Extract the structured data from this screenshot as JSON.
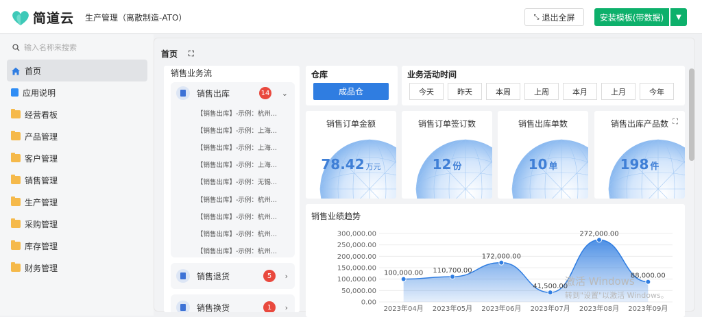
{
  "header": {
    "brand": "简道云",
    "app_title": "生产管理（离散制造-ATO）",
    "exit_fullscreen": "退出全屏",
    "install_button": "安装模板(带数据)"
  },
  "sidebar": {
    "search_placeholder": "输入名称来搜索",
    "items": [
      {
        "label": "首页",
        "icon": "home-icon"
      },
      {
        "label": "应用说明",
        "icon": "doc-icon"
      },
      {
        "label": "经营看板",
        "icon": "folder-icon"
      },
      {
        "label": "产品管理",
        "icon": "folder-icon"
      },
      {
        "label": "客户管理",
        "icon": "folder-icon"
      },
      {
        "label": "销售管理",
        "icon": "folder-icon"
      },
      {
        "label": "生产管理",
        "icon": "folder-icon"
      },
      {
        "label": "采购管理",
        "icon": "folder-icon"
      },
      {
        "label": "库存管理",
        "icon": "folder-icon"
      },
      {
        "label": "财务管理",
        "icon": "folder-icon"
      }
    ]
  },
  "tabs": {
    "home": "首页"
  },
  "flow": {
    "title": "销售业务流",
    "groups": [
      {
        "label": "销售出库",
        "count": "14",
        "rows": [
          "【销售出库】-示例：杭州...",
          "【销售出库】-示例：上海...",
          "【销售出库】-示例：上海...",
          "【销售出库】-示例：上海...",
          "【销售出库】-示例：无锡...",
          "【销售出库】-示例：杭州...",
          "【销售出库】-示例：杭州...",
          "【销售出库】-示例：杭州...",
          "【销售出库】-示例：杭州..."
        ]
      },
      {
        "label": "销售退货",
        "count": "5"
      },
      {
        "label": "销售换货",
        "count": "1"
      }
    ]
  },
  "warehouse": {
    "title": "仓库",
    "button": "成品仓"
  },
  "activity_time": {
    "title": "业务活动时间",
    "buttons": [
      "今天",
      "昨天",
      "本周",
      "上周",
      "本月",
      "上月",
      "今年"
    ]
  },
  "kpis": [
    {
      "title": "销售订单金额",
      "value": "78.42",
      "unit": "万元"
    },
    {
      "title": "销售订单签订数",
      "value": "12",
      "unit": "份"
    },
    {
      "title": "销售出库单数",
      "value": "10",
      "unit": "单"
    },
    {
      "title": "销售出库产品数",
      "value": "198",
      "unit": "件"
    }
  ],
  "chart_data": {
    "type": "area",
    "title": "销售业绩趋势",
    "x": [
      "2023年04月",
      "2023年05月",
      "2023年06月",
      "2023年07月",
      "2023年08月",
      "2023年09月"
    ],
    "values": [
      100000,
      110700,
      172000,
      41500,
      272000,
      88000
    ],
    "data_labels": [
      "100,000.00",
      "110,700.00",
      "172,000.00",
      "41,500.00",
      "272,000.00",
      "88,000.00"
    ],
    "yticks": [
      "300,000.00",
      "250,000.00",
      "200,000.00",
      "150,000.00",
      "100,000.00",
      "50,000.00",
      "0.00"
    ],
    "ylim": [
      0,
      300000
    ],
    "color": "#2f7de1"
  },
  "watermark": {
    "line1": "激活 Windows",
    "line2": "转到\"设置\"以激活 Windows。"
  }
}
